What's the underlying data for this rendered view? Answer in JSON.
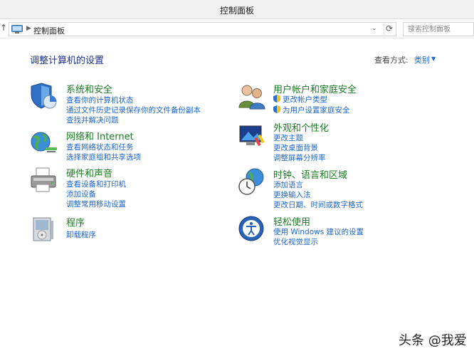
{
  "window": {
    "title": "控制面板"
  },
  "address": {
    "breadcrumb": "控制面板",
    "search_placeholder": "搜索控制面板"
  },
  "main": {
    "title": "调整计算机的设置",
    "view_by_label": "查看方式:",
    "view_by_value": "类别"
  },
  "categories": [
    {
      "name": "系统和安全",
      "links": [
        "查看你的计算机状态",
        "通过文件历史记录保存你的文件备份副本",
        "查找并解决问题"
      ]
    },
    {
      "name": "网络和 Internet",
      "links": [
        "查看网络状态和任务",
        "选择家庭组和共享选项"
      ]
    },
    {
      "name": "硬件和声音",
      "links": [
        "查看设备和打印机",
        "添加设备",
        "调整常用移动设置"
      ]
    },
    {
      "name": "程序",
      "links": [
        "卸载程序"
      ]
    },
    {
      "name": "用户帐户和家庭安全",
      "links": [
        "更改帐户类型",
        "为用户设置家庭安全"
      ]
    },
    {
      "name": "外观和个性化",
      "links": [
        "更改主题",
        "更改桌面背景",
        "调整屏幕分辨率"
      ]
    },
    {
      "name": "时钟、语言和区域",
      "links": [
        "添加语言",
        "更换输入法",
        "更改日期、时间或数字格式"
      ]
    },
    {
      "name": "轻松使用",
      "links": [
        "使用 Windows 建议的设置",
        "优化视觉显示"
      ]
    }
  ],
  "icons": {
    "system_security": "shield-pie-icon",
    "network": "globe-network-icon",
    "hardware": "printer-icon",
    "programs": "programs-box-icon",
    "users": "users-icon",
    "appearance": "display-paint-icon",
    "clock": "clock-globe-icon",
    "ease": "ease-of-access-icon"
  },
  "watermark": "头条 @我爱"
}
